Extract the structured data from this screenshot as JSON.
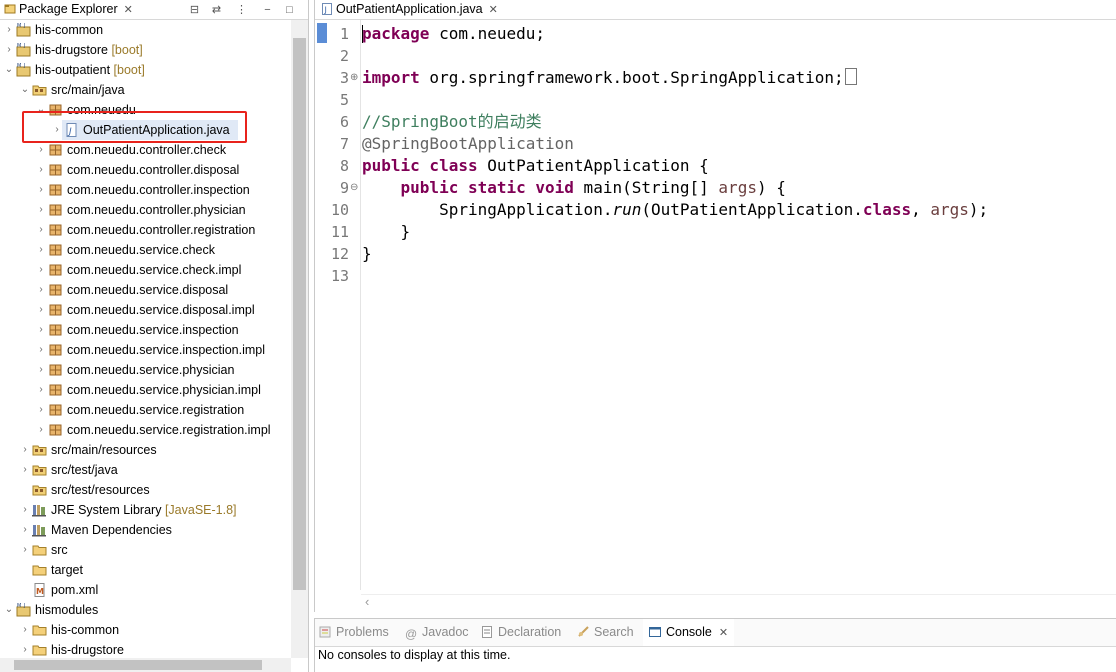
{
  "explorer": {
    "tab_title": "Package Explorer",
    "close": "✕",
    "toolbar": {
      "collapse": "⊟",
      "link": "⇄",
      "menu": "⋮",
      "minimize": "−",
      "maximize": "□"
    },
    "items": [
      {
        "label": "his-common",
        "deco": "",
        "icon": "maven-project-icon",
        "expand": "›"
      },
      {
        "label": "his-drugstore",
        "deco": "[boot]",
        "icon": "maven-project-icon",
        "expand": "›"
      },
      {
        "label": "his-outpatient",
        "deco": "[boot]",
        "icon": "maven-project-icon",
        "expand": "⌄"
      },
      {
        "label": "src/main/java",
        "deco": "",
        "icon": "source-folder-icon",
        "expand": "⌄"
      },
      {
        "label": "com.neuedu",
        "deco": "",
        "icon": "package-icon",
        "expand": "⌄"
      },
      {
        "label": "OutPatientApplication.java",
        "deco": "",
        "icon": "java-file-icon",
        "expand": "›"
      },
      {
        "label": "com.neuedu.controller.check",
        "deco": "",
        "icon": "package-icon",
        "expand": "›"
      },
      {
        "label": "com.neuedu.controller.disposal",
        "deco": "",
        "icon": "package-icon",
        "expand": "›"
      },
      {
        "label": "com.neuedu.controller.inspection",
        "deco": "",
        "icon": "package-icon",
        "expand": "›"
      },
      {
        "label": "com.neuedu.controller.physician",
        "deco": "",
        "icon": "package-icon",
        "expand": "›"
      },
      {
        "label": "com.neuedu.controller.registration",
        "deco": "",
        "icon": "package-icon",
        "expand": "›"
      },
      {
        "label": "com.neuedu.service.check",
        "deco": "",
        "icon": "package-icon",
        "expand": "›"
      },
      {
        "label": "com.neuedu.service.check.impl",
        "deco": "",
        "icon": "package-icon",
        "expand": "›"
      },
      {
        "label": "com.neuedu.service.disposal",
        "deco": "",
        "icon": "package-icon",
        "expand": "›"
      },
      {
        "label": "com.neuedu.service.disposal.impl",
        "deco": "",
        "icon": "package-icon",
        "expand": "›"
      },
      {
        "label": "com.neuedu.service.inspection",
        "deco": "",
        "icon": "package-icon",
        "expand": "›"
      },
      {
        "label": "com.neuedu.service.inspection.impl",
        "deco": "",
        "icon": "package-icon",
        "expand": "›"
      },
      {
        "label": "com.neuedu.service.physician",
        "deco": "",
        "icon": "package-icon",
        "expand": "›"
      },
      {
        "label": "com.neuedu.service.physician.impl",
        "deco": "",
        "icon": "package-icon",
        "expand": "›"
      },
      {
        "label": "com.neuedu.service.registration",
        "deco": "",
        "icon": "package-icon",
        "expand": "›"
      },
      {
        "label": "com.neuedu.service.registration.impl",
        "deco": "",
        "icon": "package-icon",
        "expand": "›"
      },
      {
        "label": "src/main/resources",
        "deco": "",
        "icon": "source-folder-icon",
        "expand": "›"
      },
      {
        "label": "src/test/java",
        "deco": "",
        "icon": "source-folder-icon",
        "expand": "›"
      },
      {
        "label": "src/test/resources",
        "deco": "",
        "icon": "source-folder-icon",
        "expand": ""
      },
      {
        "label": "JRE System Library",
        "deco": "[JavaSE-1.8]",
        "icon": "library-icon",
        "expand": "›"
      },
      {
        "label": "Maven Dependencies",
        "deco": "",
        "icon": "library-icon",
        "expand": "›"
      },
      {
        "label": "src",
        "deco": "",
        "icon": "folder-icon",
        "expand": "›"
      },
      {
        "label": "target",
        "deco": "",
        "icon": "folder-icon",
        "expand": ""
      },
      {
        "label": "pom.xml",
        "deco": "",
        "icon": "xml-file-icon",
        "expand": ""
      },
      {
        "label": "hismodules",
        "deco": "",
        "icon": "maven-project-icon",
        "expand": "⌄"
      },
      {
        "label": "his-common",
        "deco": "",
        "icon": "folder-icon",
        "expand": "›"
      },
      {
        "label": "his-drugstore",
        "deco": "",
        "icon": "folder-icon",
        "expand": "›"
      }
    ]
  },
  "editor": {
    "tab_title": "OutPatientApplication.java",
    "close": "✕",
    "line_numbers": [
      "1",
      "2",
      "3",
      "5",
      "6",
      "7",
      "8",
      "9",
      "10",
      "11",
      "12",
      "13"
    ],
    "fold_markers": {
      "3": "⊕",
      "9": "⊖"
    },
    "code": {
      "l1_kw": "package",
      "l1_rest": " com.neuedu;",
      "l3_kw": "import",
      "l3_rest": " org.springframework.boot.SpringApplication;",
      "l5": "",
      "l6": "//SpringBoot的启动类",
      "l7": "@SpringBootApplication",
      "l8_kw": "public class",
      "l8_rest": " OutPatientApplication {",
      "l9_kw": "    public static void",
      "l9_rest": " main(String[] ",
      "l9_var": "args",
      "l9_end": ") {",
      "l10_a": "        SpringApplication.",
      "l10_run": "run",
      "l10_b": "(OutPatientApplication.",
      "l10_kw": "class",
      "l10_c": ", ",
      "l10_var": "args",
      "l10_d": ");",
      "l11": "    }",
      "l12": "}"
    },
    "hscroll_arrow": "‹"
  },
  "console": {
    "tabs": [
      {
        "label": "Problems",
        "icon": "problems-icon"
      },
      {
        "label": "Javadoc",
        "icon": "javadoc-icon"
      },
      {
        "label": "Declaration",
        "icon": "declaration-icon"
      },
      {
        "label": "Search",
        "icon": "search-icon"
      },
      {
        "label": "Console",
        "icon": "console-icon"
      }
    ],
    "close": "✕",
    "message": "No consoles to display at this time."
  }
}
